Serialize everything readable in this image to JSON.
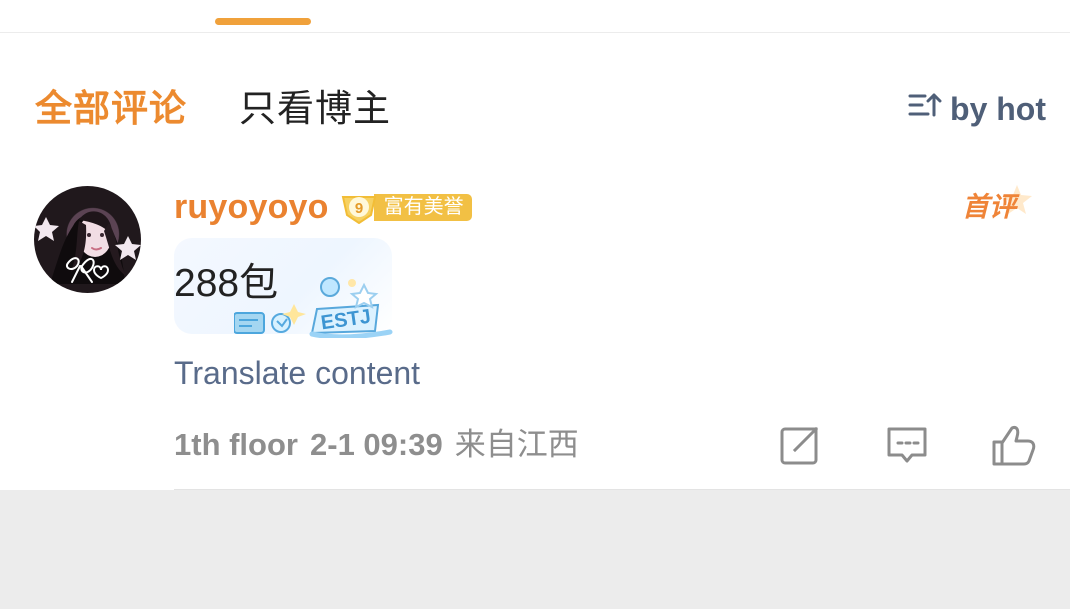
{
  "header": {
    "active_tab": "全部评论",
    "tabs": [
      {
        "label": "全部评论"
      },
      {
        "label": "只看博主"
      }
    ],
    "sort": {
      "label": "by hot",
      "icon": "sort-icon"
    }
  },
  "comment": {
    "username": "ruyoyoyo",
    "badge": {
      "level": "9",
      "label": "富有美誉",
      "color": "#f2c044"
    },
    "first_comment_label": "首评",
    "text": "288包",
    "sticker_label": "ESTJ",
    "translate_label": "Translate content",
    "floor": "1th floor",
    "time": "2-1 09:39",
    "location": "来自江西",
    "actions": [
      {
        "name": "share",
        "icon": "share-icon"
      },
      {
        "name": "reply",
        "icon": "comment-icon"
      },
      {
        "name": "like",
        "icon": "thumbs-up-icon"
      }
    ]
  },
  "colors": {
    "accent_orange": "#ec8a2f",
    "link_blue_gray": "#596b8a",
    "muted_gray": "#8f8f8f",
    "background_gray": "#ececec"
  }
}
